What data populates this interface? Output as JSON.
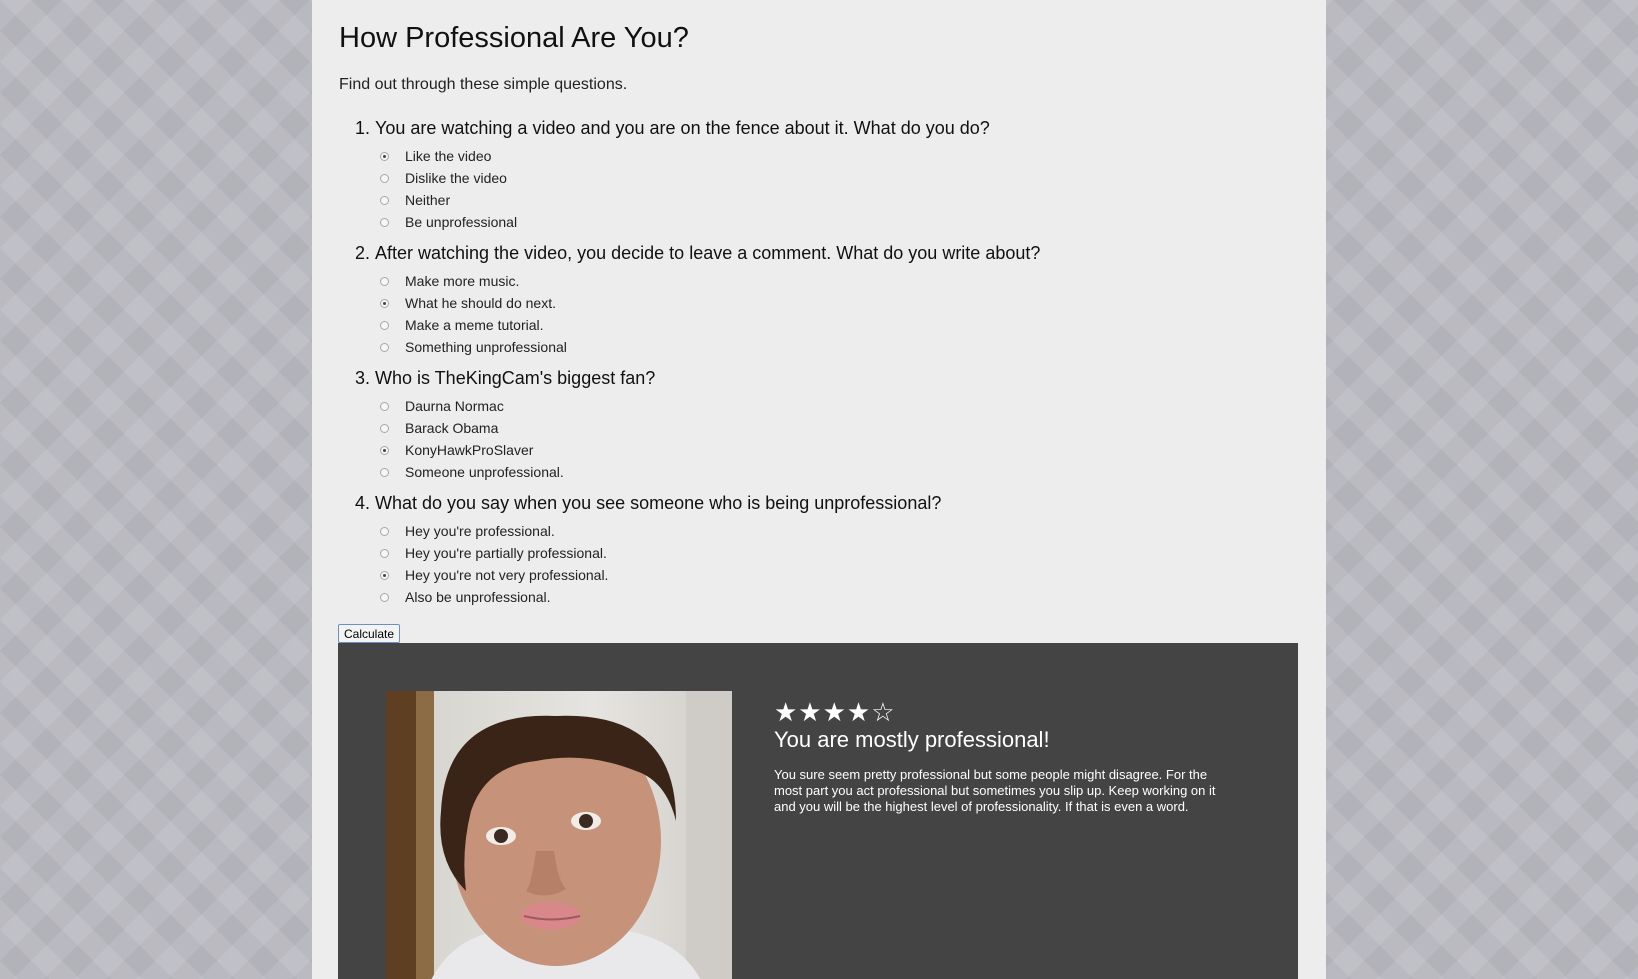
{
  "page": {
    "title": "How Professional Are You?",
    "subtitle": "Find out through these simple questions."
  },
  "questions": [
    {
      "number": "1.",
      "text": "You are watching a video and you are on the fence about it. What do you do?",
      "options": [
        "Like the video",
        "Dislike the video",
        "Neither",
        "Be unprofessional"
      ],
      "selected": 0
    },
    {
      "number": "2.",
      "text": "After watching the video, you decide to leave a comment. What do you write about?",
      "options": [
        "Make more music.",
        "What he should do next.",
        "Make a meme tutorial.",
        "Something unprofessional"
      ],
      "selected": 1
    },
    {
      "number": "3.",
      "text": "Who is TheKingCam's biggest fan?",
      "options": [
        "Daurna Normac",
        "Barack Obama",
        "KonyHawkProSlaver",
        "Someone unprofessional."
      ],
      "selected": 2
    },
    {
      "number": "4.",
      "text": "What do you say when you see someone who is being unprofessional?",
      "options": [
        "Hey you're professional.",
        "Hey you're partially professional.",
        "Hey you're not very professional.",
        "Also be unprofessional."
      ],
      "selected": 2
    }
  ],
  "calculate_label": "Calculate",
  "result": {
    "rating": 4,
    "rating_max": 5,
    "stars_text": "★★★★☆",
    "title": "You are mostly professional!",
    "description": "You sure seem pretty professional but some people might disagree. For the most part you act professional but sometimes you slip up. Keep working on it and you will be the highest level of professionality. If that is even a word."
  }
}
